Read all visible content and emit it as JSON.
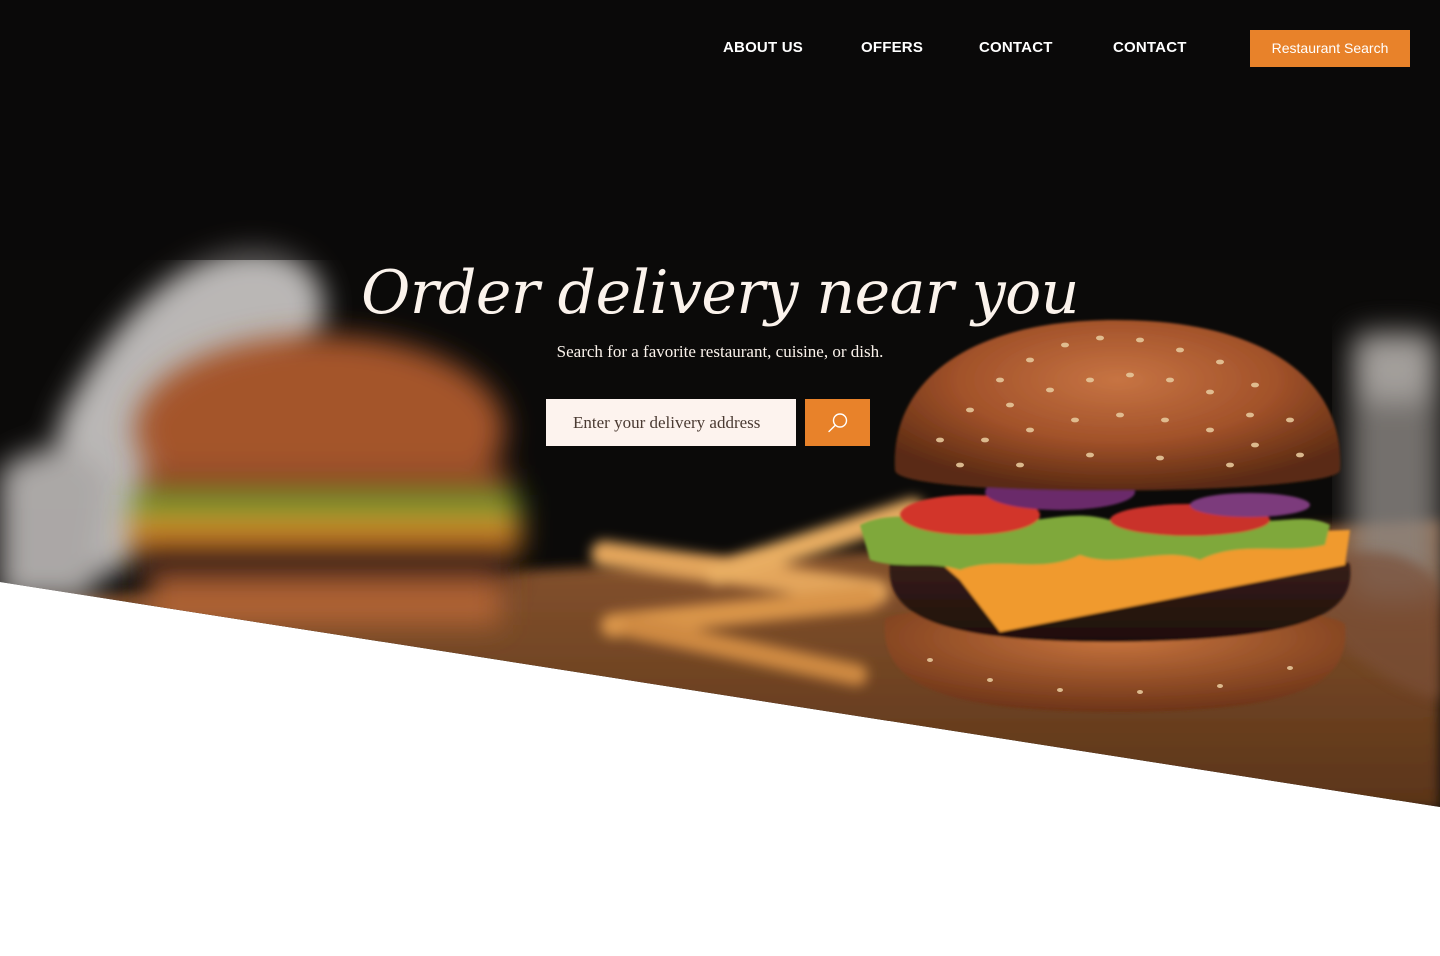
{
  "nav": {
    "links": [
      {
        "label": "ABOUT US"
      },
      {
        "label": "OFFERS"
      },
      {
        "label": "CONTACT"
      },
      {
        "label": "CONTACT"
      }
    ],
    "cta_label": "Restaurant Search"
  },
  "hero": {
    "title": "Order delivery near you",
    "subtitle": "Search for a favorite restaurant, cuisine, or dish.",
    "search": {
      "placeholder": "Enter your delivery address",
      "button_icon": "search-icon"
    },
    "image_subject": "burger-icon"
  },
  "colors": {
    "accent": "#e8822a",
    "hero_background": "#0b0a09",
    "hero_text": "#fbf3ec",
    "input_background": "#fdf3ee"
  }
}
